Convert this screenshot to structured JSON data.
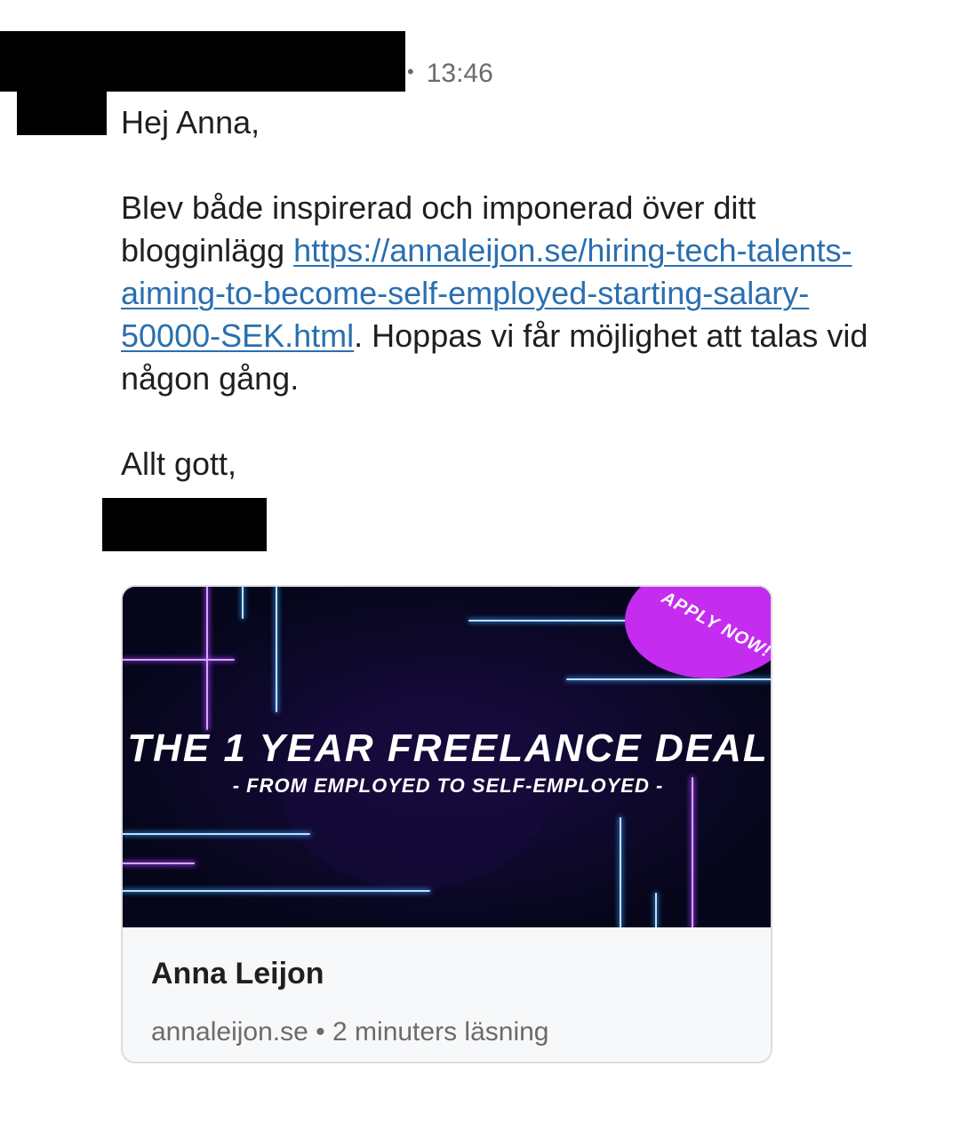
{
  "message": {
    "time": "13:46",
    "separator": "•",
    "greeting": "Hej Anna,",
    "paragraph_before_link": "Blev både inspirerad och imponerad över ditt blogginlägg ",
    "link_text": "https://annaleijon.se/hiring-tech-talents-aiming-to-become-self-employed-starting-salary-50000-SEK.html",
    "paragraph_after_link": ". Hoppas vi får möjlighet att talas vid någon gång.",
    "closing": "Allt gott,"
  },
  "link_preview": {
    "banner": {
      "badge": "APPLY NOW!",
      "headline": "THE 1 YEAR FREELANCE DEAL",
      "subheadline": "- FROM EMPLOYED TO SELF-EMPLOYED -",
      "colors": {
        "background": "#050619",
        "neon_blue": "#3aa0ff",
        "neon_purple": "#a23cff",
        "badge": "#c42cf0"
      }
    },
    "title": "Anna Leijon",
    "domain": "annaleijon.se",
    "separator": "•",
    "read_time": "2 minuters läsning"
  }
}
